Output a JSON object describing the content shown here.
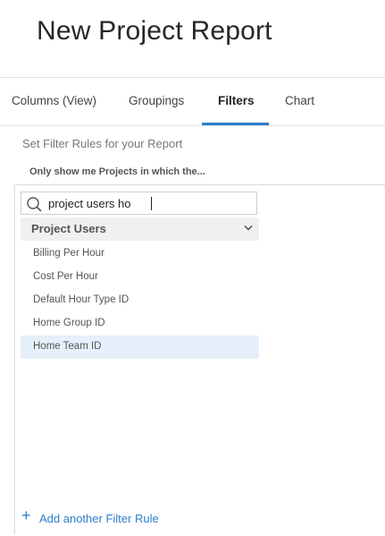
{
  "header": {
    "title": "New Project Report"
  },
  "tabs": [
    {
      "label": "Columns (View)",
      "active": false
    },
    {
      "label": "Groupings",
      "active": false
    },
    {
      "label": "Filters",
      "active": true
    },
    {
      "label": "Chart",
      "active": false
    }
  ],
  "filters": {
    "subtitle": "Set Filter Rules for your Report",
    "rule_heading": "Only show me Projects in which the...",
    "search": {
      "value": "project users ho",
      "icon": "search-icon"
    },
    "group": {
      "label": "Project Users",
      "icon": "chevron-down-icon"
    },
    "options": [
      {
        "label": "Billing Per Hour",
        "selected": false
      },
      {
        "label": "Cost Per Hour",
        "selected": false
      },
      {
        "label": "Default Hour Type ID",
        "selected": false
      },
      {
        "label": "Home Group ID",
        "selected": false
      },
      {
        "label": "Home Team ID",
        "selected": true
      }
    ],
    "add_rule": {
      "icon": "plus-icon",
      "label": "Add another Filter Rule"
    }
  },
  "colors": {
    "accent": "#2e7fc7",
    "selected_bg": "#e6f0fa",
    "group_bg": "#f0f0f0"
  }
}
